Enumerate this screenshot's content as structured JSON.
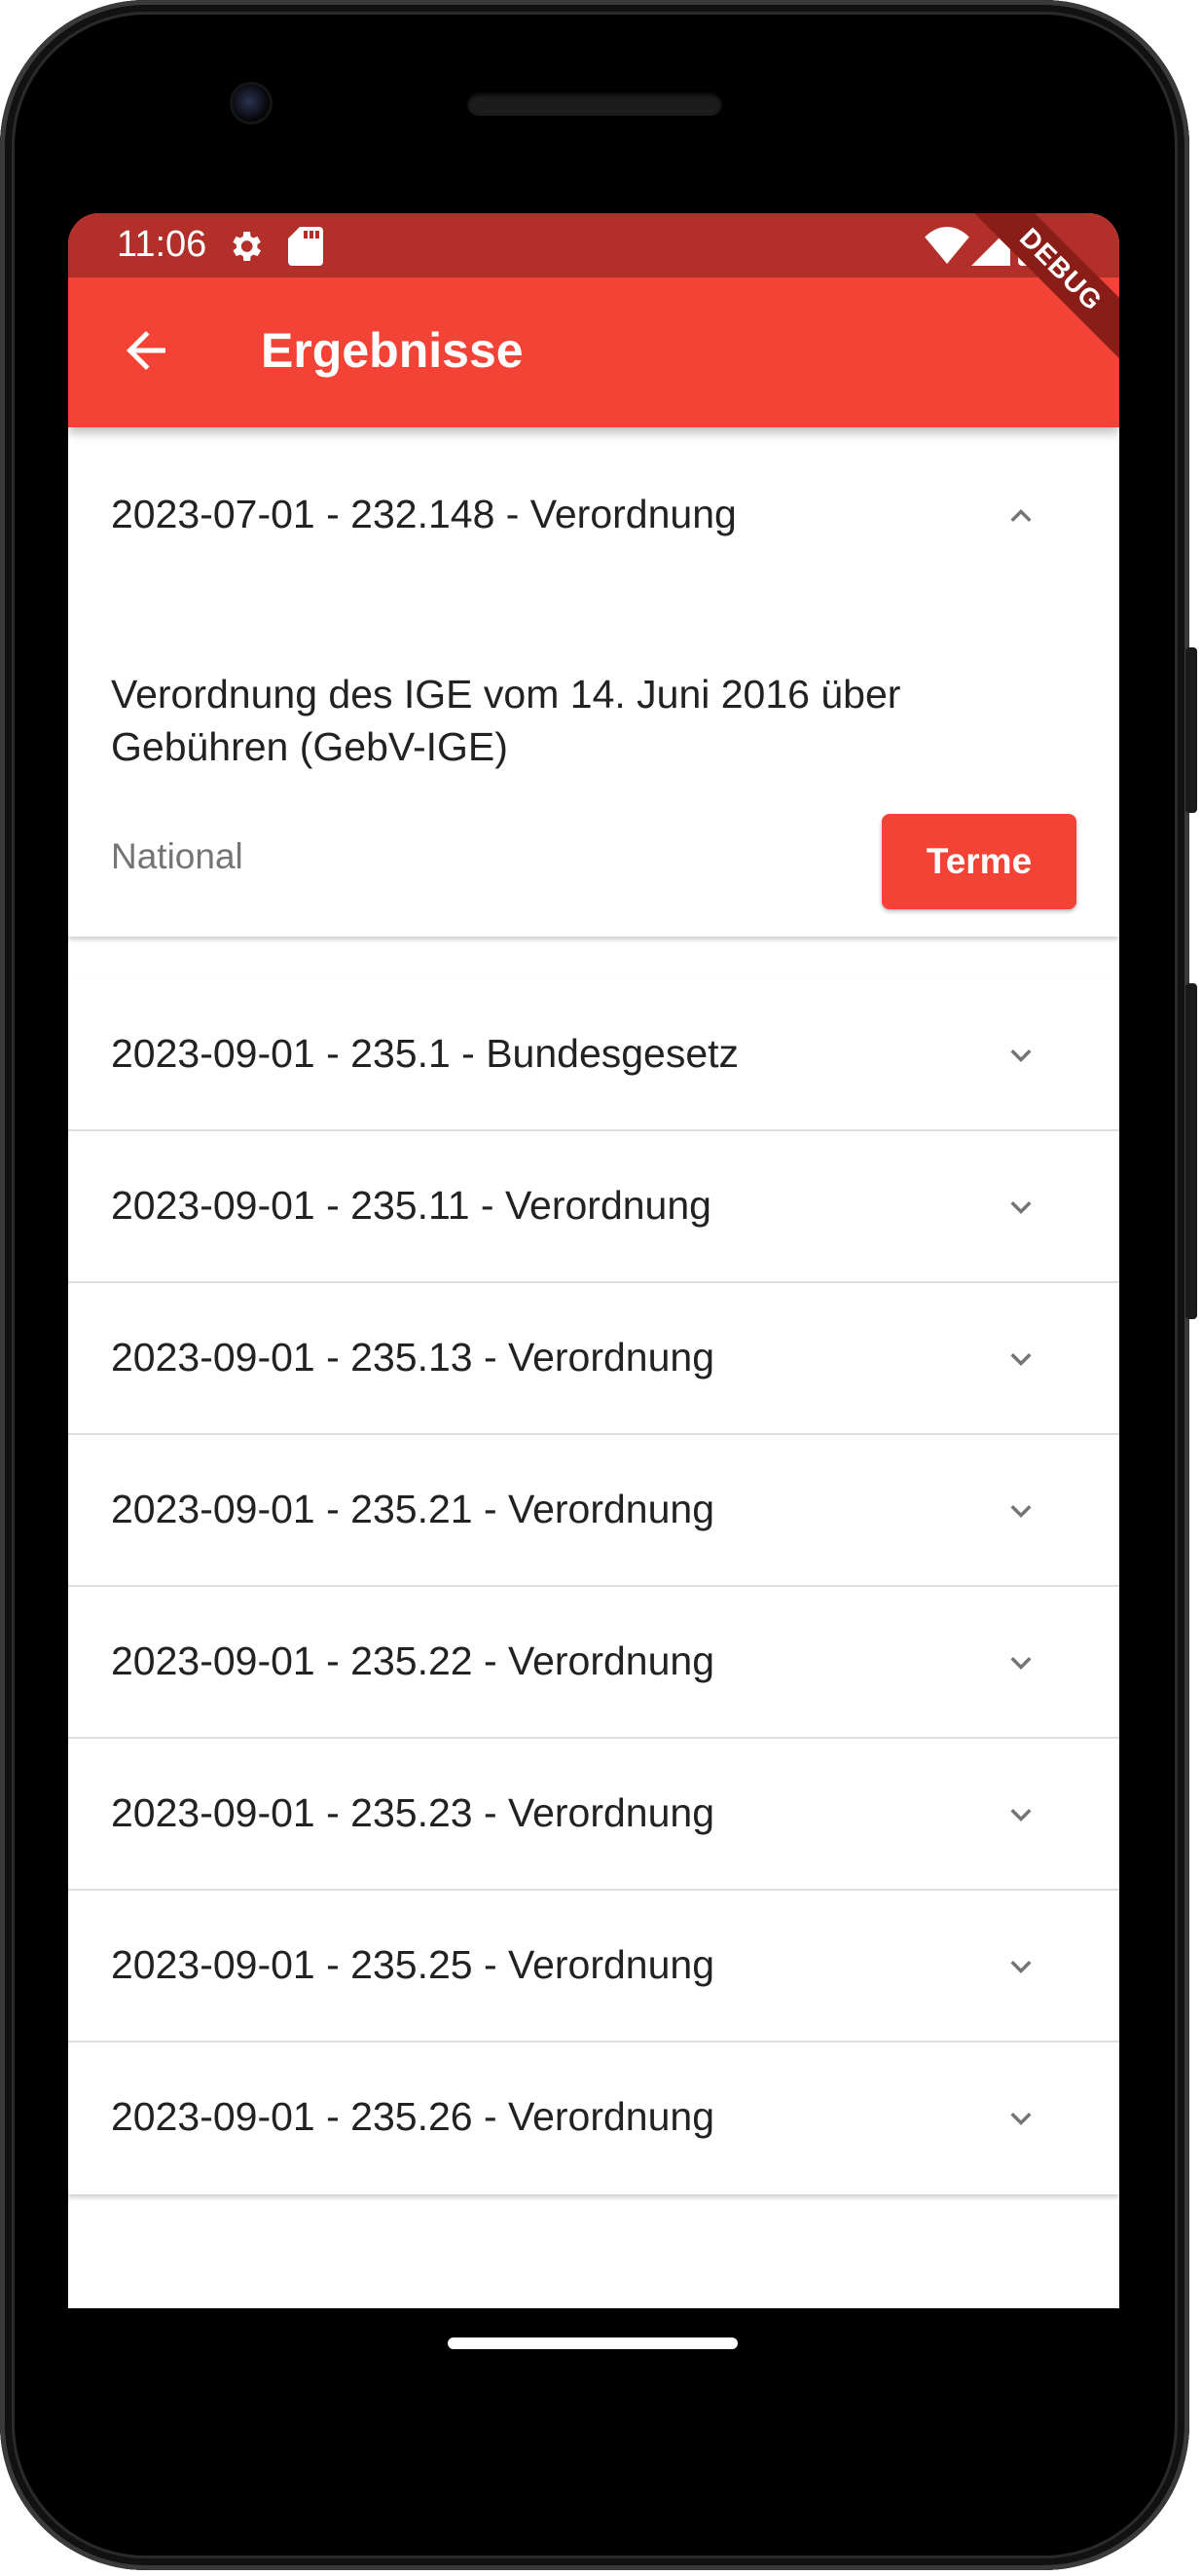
{
  "status": {
    "time": "11:06"
  },
  "appbar": {
    "title": "Ergebnisse",
    "debug_banner": "DEBUG"
  },
  "expanded": {
    "header": "2023-07-01 - 232.148 - Verordnung",
    "description": "Verordnung des IGE vom 14. Juni 2016 über Gebühren (GebV-IGE)",
    "scope": "National",
    "button_label": "Terme"
  },
  "items": [
    {
      "label": "2023-09-01 - 235.1 - Bundesgesetz"
    },
    {
      "label": "2023-09-01 - 235.11 - Verordnung"
    },
    {
      "label": "2023-09-01 - 235.13 - Verordnung"
    },
    {
      "label": "2023-09-01 - 235.21 - Verordnung"
    },
    {
      "label": "2023-09-01 - 235.22 - Verordnung"
    },
    {
      "label": "2023-09-01 - 235.23 - Verordnung"
    },
    {
      "label": "2023-09-01 - 235.25 - Verordnung"
    },
    {
      "label": "2023-09-01 - 235.26 - Verordnung"
    }
  ],
  "colors": {
    "primary": "#f34336",
    "status_bar": "#b3302a"
  }
}
